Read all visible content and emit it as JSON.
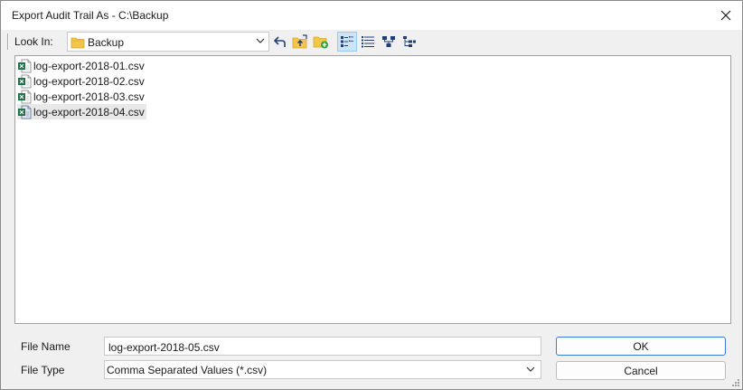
{
  "window": {
    "title": "Export Audit Trail As - C:\\Backup"
  },
  "toolbar": {
    "look_in_label": "Look In:",
    "look_in_value": "Backup",
    "icons": [
      "back-icon",
      "up-folder-icon",
      "new-folder-icon",
      "list-view-icon",
      "details-view-icon",
      "tree-view-icon",
      "hierarchy-view-icon"
    ]
  },
  "files": [
    {
      "name": "log-export-2018-01.csv",
      "icon": "excel-csv-icon"
    },
    {
      "name": "log-export-2018-02.csv",
      "icon": "excel-csv-icon"
    },
    {
      "name": "log-export-2018-03.csv",
      "icon": "excel-csv-icon"
    },
    {
      "name": "log-export-2018-04.csv",
      "icon": "excel-csv-icon",
      "selected": true
    }
  ],
  "form": {
    "file_name_label": "File Name",
    "file_name_value": "log-export-2018-05.csv",
    "file_type_label": "File Type",
    "file_type_value": "Comma Separated Values (*.csv)"
  },
  "buttons": {
    "ok": "OK",
    "cancel": "Cancel"
  },
  "colors": {
    "folder": "#f3c64b",
    "excel_green": "#1d7044",
    "accent": "#3c7bd6",
    "selection": "#cce4f7"
  }
}
